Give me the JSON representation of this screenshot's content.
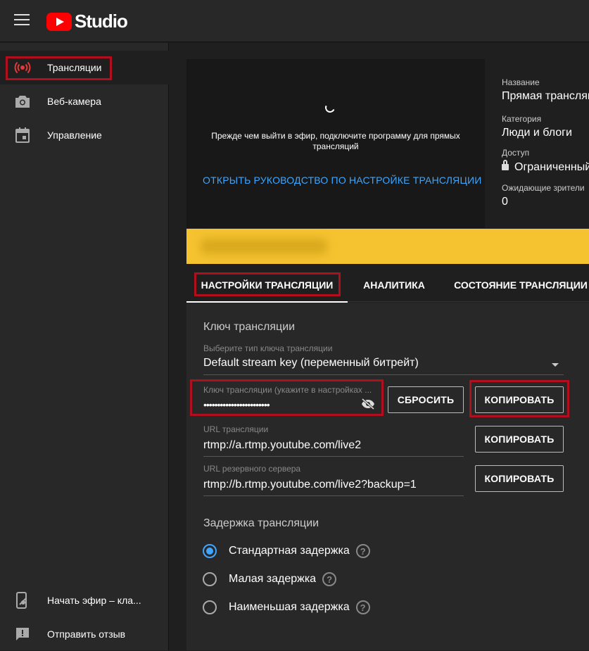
{
  "app": {
    "logo_text": "Studio"
  },
  "sidebar": {
    "items": [
      {
        "label": "Трансляции",
        "icon": "broadcast-icon"
      },
      {
        "label": "Веб-камера",
        "icon": "camera-icon"
      },
      {
        "label": "Управление",
        "icon": "calendar-icon"
      }
    ],
    "bottom_items": [
      {
        "label": "Начать эфир – кла...",
        "icon": "mobile-live-icon"
      },
      {
        "label": "Отправить отзыв",
        "icon": "feedback-icon"
      }
    ]
  },
  "preview": {
    "message": "Прежде чем выйти в эфир, подключите программу для прямых трансляций",
    "guide_link": "ОТКРЫТЬ РУКОВОДСТВО ПО НАСТРОЙКЕ ТРАНСЛЯЦИИ"
  },
  "info": {
    "title_label": "Название",
    "title_value": "Прямая трансляция",
    "category_label": "Категория",
    "category_value": "Люди и блоги",
    "access_label": "Доступ",
    "access_value": "Ограниченный",
    "viewers_label": "Ожидающие зрители",
    "viewers_value": "0"
  },
  "tabs": [
    {
      "label": "НАСТРОЙКИ ТРАНСЛЯЦИИ",
      "active": true
    },
    {
      "label": "АНАЛИТИКА",
      "active": false
    },
    {
      "label": "СОСТОЯНИЕ ТРАНСЛЯЦИИ",
      "active": false
    }
  ],
  "stream_key": {
    "section_title": "Ключ трансляции",
    "type_label": "Выберите тип ключа трансляции",
    "type_value": "Default stream key (переменный битрейт)",
    "key_label": "Ключ трансляции (укажите в настройках ...",
    "key_value": "••••••••••••••••••••••••",
    "reset_button": "СБРОСИТЬ",
    "copy_button": "КОПИРОВАТЬ",
    "url_label": "URL трансляции",
    "url_value": "rtmp://a.rtmp.youtube.com/live2",
    "backup_label": "URL резервного сервера",
    "backup_value": "rtmp://b.rtmp.youtube.com/live2?backup=1"
  },
  "latency": {
    "section_title": "Задержка трансляции",
    "options": [
      {
        "label": "Стандартная задержка",
        "checked": true
      },
      {
        "label": "Малая задержка",
        "checked": false
      },
      {
        "label": "Наименьшая задержка",
        "checked": false
      }
    ]
  },
  "colors": {
    "accent": "#3ea6ff",
    "highlight_box": "#b10f1d",
    "brand": "#ff0000",
    "banner": "#f5c330"
  }
}
